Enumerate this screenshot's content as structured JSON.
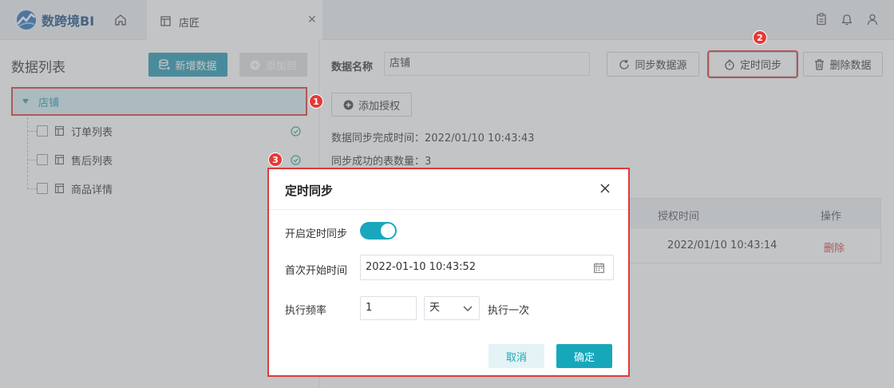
{
  "app": {
    "logo_text": "数跨境BI"
  },
  "tab": {
    "label": "店匠"
  },
  "left": {
    "title": "数据列表",
    "new_button": "新增数据",
    "add_to_button": "添加到",
    "root": {
      "label": "店铺"
    },
    "items": [
      {
        "label": "订单列表",
        "synced": true
      },
      {
        "label": "售后列表",
        "synced": true
      },
      {
        "label": "商品详情",
        "synced": false
      }
    ]
  },
  "right": {
    "name_label": "数据名称",
    "name_value": "店铺",
    "sync_button": "同步数据源",
    "timer_button": "定时同步",
    "delete_button": "删除数据",
    "auth_button": "添加授权",
    "sync_time": "数据同步完成时间：2022/01/10 10:43:43",
    "sync_count": "同步成功的表数量：3",
    "table": {
      "headers": [
        "授权时间",
        "操作"
      ],
      "rows": [
        {
          "time": "2022/01/10 10:43:14",
          "action": "删除"
        }
      ]
    }
  },
  "modal": {
    "title": "定时同步",
    "enable_label": "开启定时同步",
    "enabled": true,
    "start_label": "首次开始时间",
    "start_value": "2022-01-10 10:43:52",
    "freq_label": "执行频率",
    "freq_value": "1",
    "freq_unit": "天",
    "freq_suffix": "执行一次",
    "cancel": "取消",
    "confirm": "确定"
  },
  "badges": [
    "1",
    "2",
    "3"
  ],
  "colors": {
    "accent": "#1aa7bd",
    "primary": "#2698b1",
    "highlight": "#e03a3a",
    "danger": "#e0393e"
  }
}
